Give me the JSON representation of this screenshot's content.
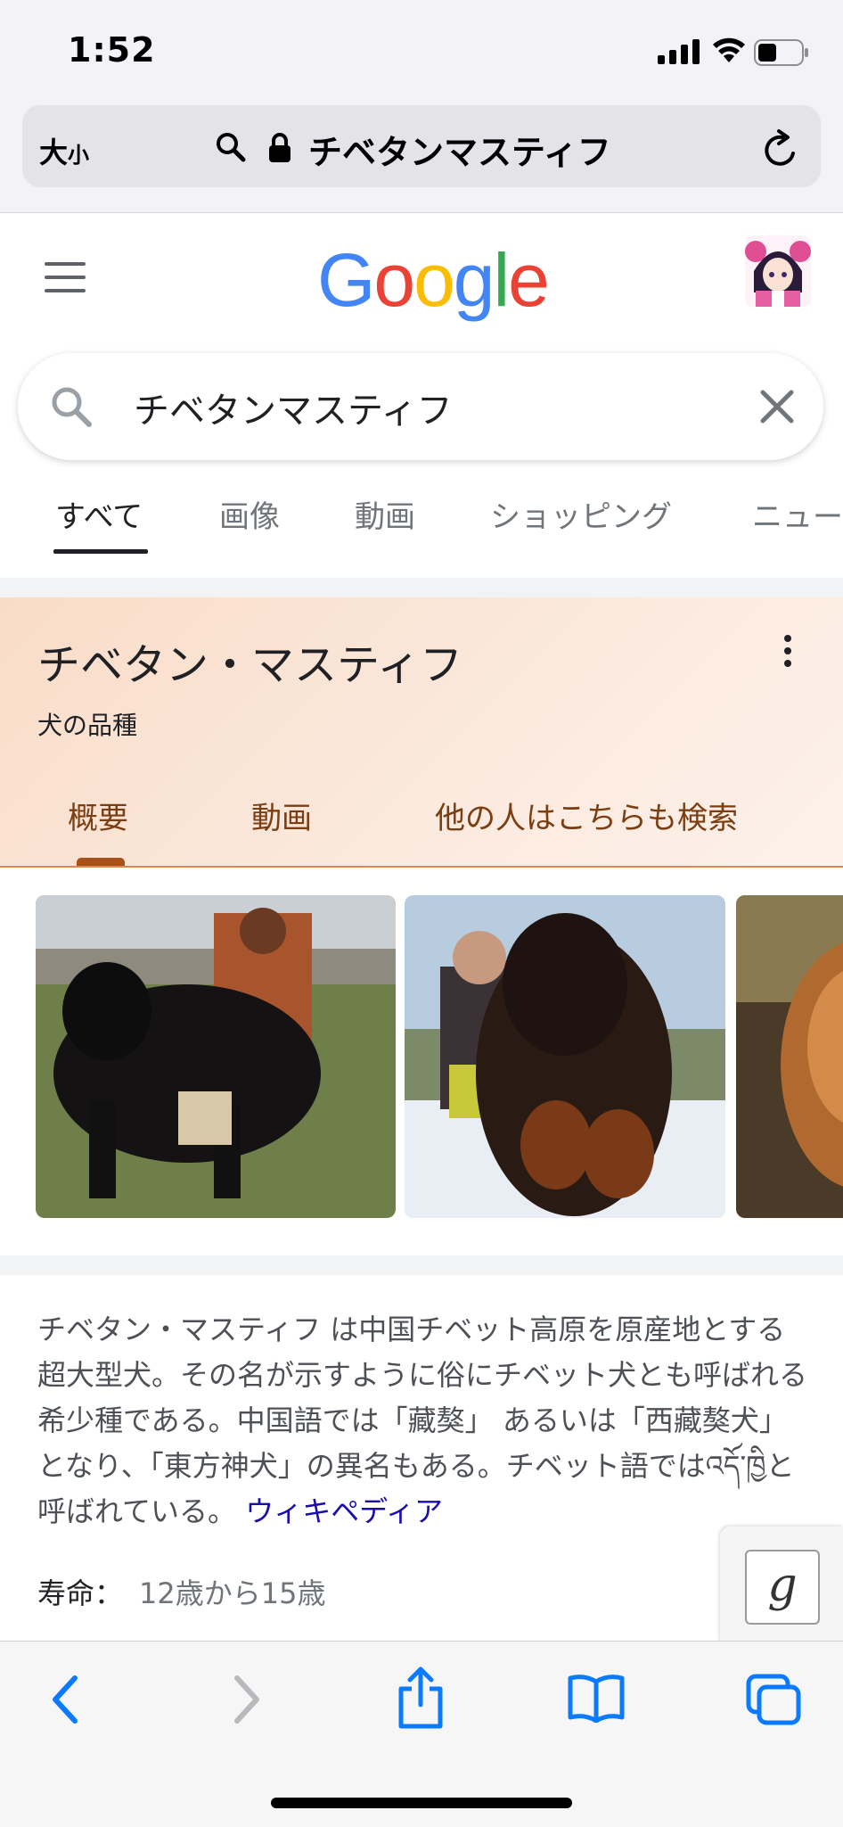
{
  "status_bar": {
    "time": "1:52"
  },
  "safari": {
    "text_size_label_big": "大",
    "text_size_label_small": "小",
    "address": "チベタンマスティフ"
  },
  "google": {
    "logo_letters": [
      {
        "ch": "G",
        "color": "#4285F4"
      },
      {
        "ch": "o",
        "color": "#EA4335"
      },
      {
        "ch": "o",
        "color": "#FBBC05"
      },
      {
        "ch": "g",
        "color": "#4285F4"
      },
      {
        "ch": "l",
        "color": "#34A853"
      },
      {
        "ch": "e",
        "color": "#EA4335"
      }
    ],
    "search_query": "チベタンマスティフ",
    "tabs": [
      "すべて",
      "画像",
      "動画",
      "ショッピング",
      "ニュー"
    ]
  },
  "knowledge_panel": {
    "title": "チベタン・マスティフ",
    "subtitle": "犬の品種",
    "tabs": [
      "概要",
      "動画",
      "他の人はこちらも検索"
    ],
    "description": "チベタン・マスティフ は中国チベット高原を原産地とする超大型犬。その名が示すように俗にチベット犬とも呼ばれる希少種である。中国語では「藏獒」 あるいは「西藏獒犬」 となり、「東方神犬」の異名もある。チベット語ではའདོ་ཁྱིと呼ばれている。",
    "source_link": "ウィキペディア",
    "lifespan_label": "寿命：",
    "lifespan_value": "12歳から15歳"
  },
  "g_button": "g",
  "colors": {
    "panel_bg": "#f9dcc8",
    "panel_tab_text": "#7a3e12",
    "link": "#1a0dab",
    "ios_blue": "#0a7aff"
  }
}
